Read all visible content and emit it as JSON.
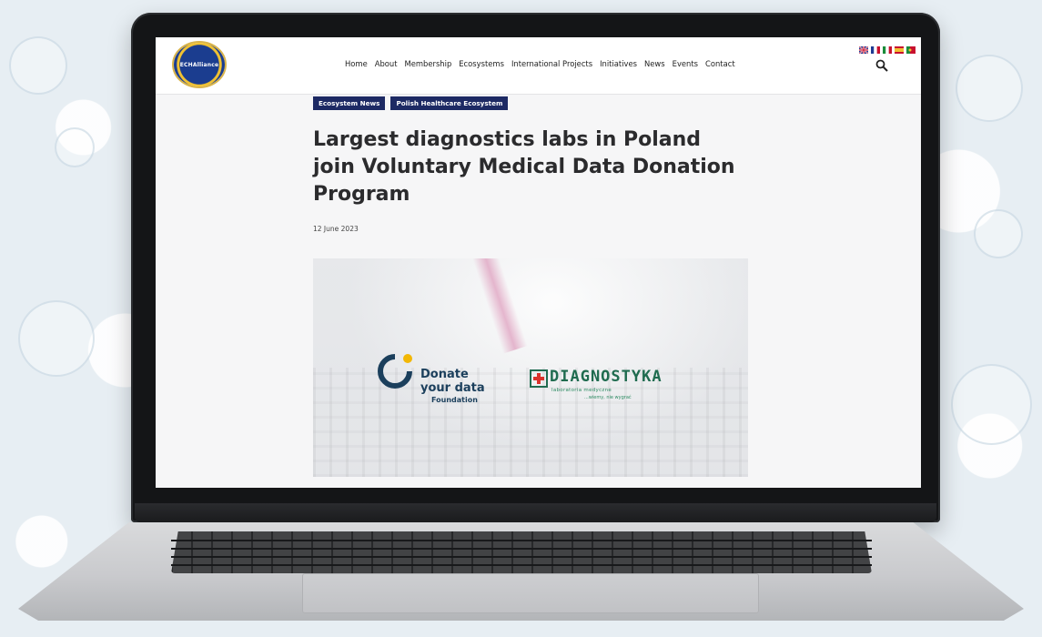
{
  "site": {
    "logo_text": "ECHAlliance",
    "nav": [
      "Home",
      "About",
      "Membership",
      "Ecosystems",
      "International Projects",
      "Initiatives",
      "News",
      "Events",
      "Contact"
    ],
    "languages": [
      {
        "code": "en",
        "colors": [
          "#1f3a93",
          "#ffffff",
          "#c8102e"
        ]
      },
      {
        "code": "fr",
        "colors": [
          "#1f3a93",
          "#ffffff",
          "#c8102e"
        ]
      },
      {
        "code": "it",
        "colors": [
          "#1a8c3a",
          "#ffffff",
          "#c8102e"
        ]
      },
      {
        "code": "es",
        "colors": [
          "#c8102e",
          "#f1c232",
          "#c8102e"
        ]
      },
      {
        "code": "pt",
        "colors": [
          "#1a8c3a",
          "#c8102e",
          "#c8102e"
        ]
      }
    ],
    "search_icon": "search-icon"
  },
  "article": {
    "tags": [
      "Ecosystem News",
      "Polish Healthcare Ecosystem"
    ],
    "title": "Largest diagnostics labs in Poland join Voluntary Medical Data Donation Program",
    "date": "12 June 2023"
  },
  "feature_image": {
    "dyd": {
      "line1": "Donate",
      "line2": "your data",
      "line3": "Foundation"
    },
    "diagnostyka": {
      "name": "DIAGNOSTYKA",
      "tagline": "laboratoria medyczne",
      "sub": "...wiemy, nie wygrać"
    }
  },
  "colors": {
    "tag_bg": "#1d2a64",
    "title_text": "#2b2b2d",
    "dyd_navy": "#1b3f5c",
    "dyd_yellow": "#f2b705",
    "diag_green": "#1f6b4f"
  }
}
